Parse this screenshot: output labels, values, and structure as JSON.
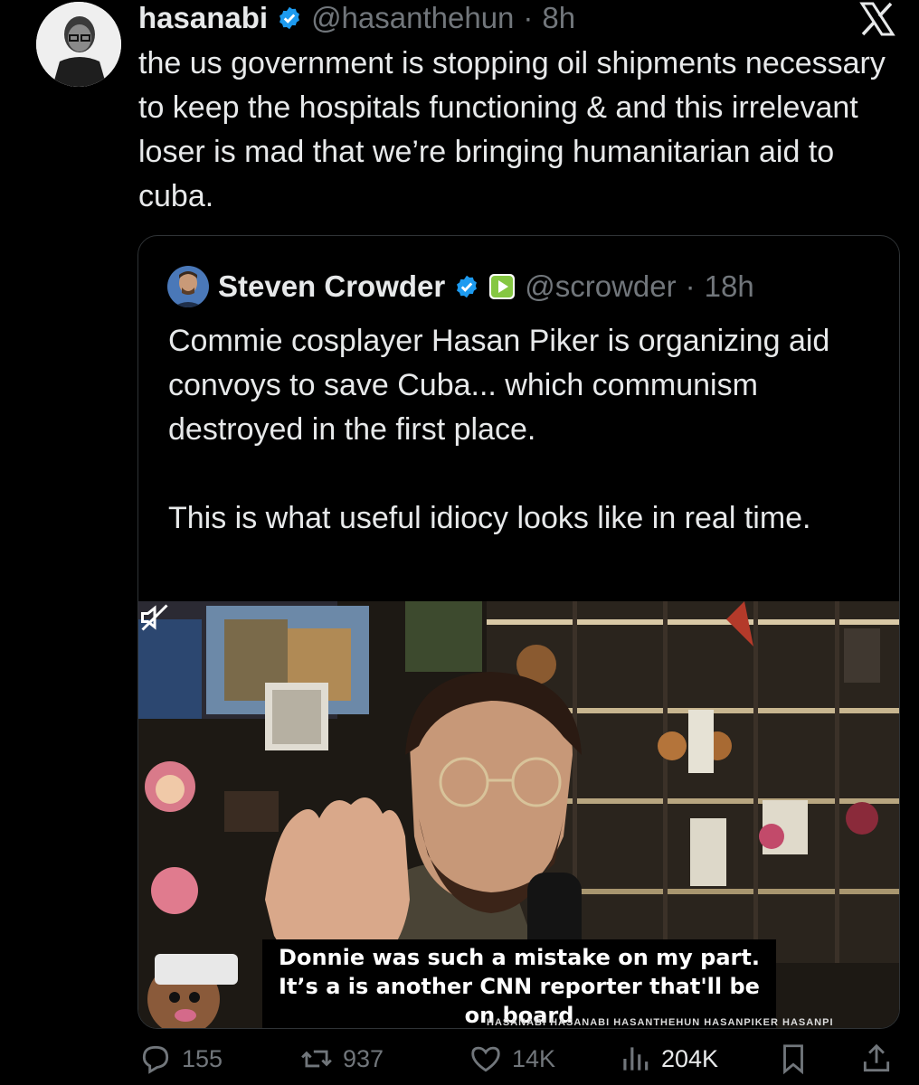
{
  "tweet": {
    "author_name": "hasanabi",
    "handle": "@hasanthehun",
    "separator": "·",
    "time": "8h",
    "text": "the us government is stopping oil shipments necessary to keep the hospitals functioning & and this irrelevant loser is mad that we’re bringing humanitarian aid to cuba."
  },
  "quote": {
    "author_name": "Steven Crowder",
    "handle": "@scrowder",
    "separator": "·",
    "time": "18h",
    "text": "Commie cosplayer Hasan Piker is organizing aid convoys to save Cuba... which communism destroyed in the first place.\n\nThis is what useful idiocy looks like in real time.",
    "video": {
      "caption": "Donnie was such a mistake on my part. It’s a is another CNN reporter that'll be on board",
      "watermark": "HASANABI   HASANABI   HASANTHEHUN   HASANPIKER   HASANPI"
    }
  },
  "actions": {
    "replies": "155",
    "reposts": "937",
    "likes": "14K",
    "views": "204K"
  },
  "icons": {
    "verified": "verified-badge-icon",
    "rumble": "rumble-icon",
    "x_logo": "x-logo-icon",
    "reply": "reply-icon",
    "repost": "repost-icon",
    "like": "heart-icon",
    "views": "views-icon",
    "bookmark": "bookmark-icon",
    "share": "share-icon",
    "mute": "mute-icon"
  },
  "colors": {
    "background": "#000000",
    "text": "#e7e9ea",
    "muted": "#71767b",
    "verified": "#1d9bf0",
    "border": "#2f3336",
    "rumble": "#85c742"
  }
}
